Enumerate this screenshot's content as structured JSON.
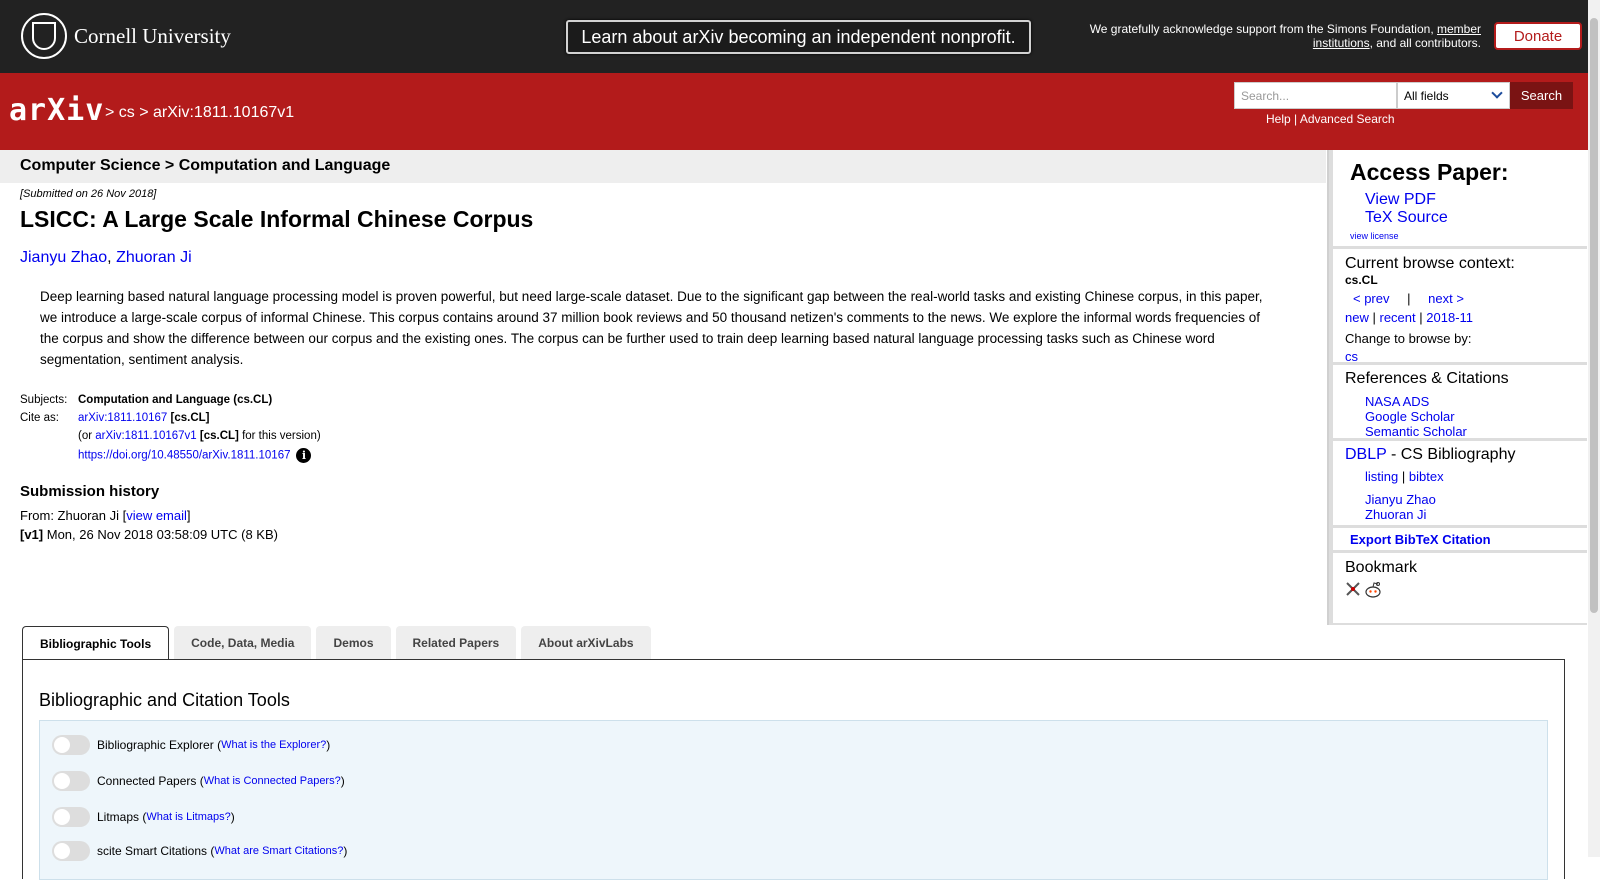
{
  "top": {
    "cornell": "Cornell University",
    "banner": "Learn about arXiv becoming an independent nonprofit.",
    "ack_prefix": "We gratefully acknowledge support from the Simons Foundation, ",
    "ack_link": "member institutions",
    "ack_suffix": ", and all contributors.",
    "donate": "Donate"
  },
  "header": {
    "logo": "arXiv",
    "bc_sep1": " > ",
    "bc_cs": "cs",
    "bc_sep2": " > ",
    "bc_id": "arXiv:1811.10167v1",
    "search_placeholder": "Search...",
    "search_field": "All fields",
    "search_button": "Search",
    "help": "Help",
    "sep": " | ",
    "advanced": "Advanced Search"
  },
  "paper": {
    "subject_bar": "Computer Science > Computation and Language",
    "submitted": "[Submitted on 26 Nov 2018]",
    "title": "LSICC: A Large Scale Informal Chinese Corpus",
    "author1": "Jianyu Zhao",
    "author_sep": ", ",
    "author2": "Zhuoran Ji",
    "abstract": "Deep learning based natural language processing model is proven powerful, but need large-scale dataset. Due to the significant gap between the real-world tasks and existing Chinese corpus, in this paper, we introduce a large-scale corpus of informal Chinese. This corpus contains around 37 million book reviews and 50 thousand netizen's comments to the news. We explore the informal words frequencies of the corpus and show the difference between our corpus and the existing ones. The corpus can be further used to train deep learning based natural language processing tasks such as Chinese word segmentation, sentiment analysis.",
    "subjects_label": "Subjects:",
    "subjects_value": "Computation and Language (cs.CL)",
    "cite_label": "Cite as:",
    "cite_id": "arXiv:1811.10167",
    "cite_cat": " [cs.CL]",
    "or_prefix": "(or ",
    "cite_v1": "arXiv:1811.10167v1",
    "cite_v1_cat": " [cs.CL]",
    "cite_v1_suffix": " for this version)",
    "doi": "https://doi.org/10.48550/arXiv.1811.10167",
    "info_icon": "i",
    "history_title": "Submission history",
    "from_prefix": "From: Zhuoran Ji [",
    "view_email": "view email",
    "from_suffix": "]",
    "v1_label": "[v1]",
    "v1_date": " Mon, 26 Nov 2018 03:58:09 UTC (8 KB)"
  },
  "sidebar": {
    "access_title": "Access Paper:",
    "view_pdf": "View PDF",
    "tex_source": "TeX Source",
    "view_license": "view license",
    "browse_title": "Current browse context:",
    "browse_cat": "cs.CL",
    "prev": "< prev",
    "pipe": "|",
    "next": "next >",
    "new": "new",
    "recent": "recent",
    "month": "2018-11",
    "change_browse": "Change to browse by:",
    "cs": "cs",
    "refs_title": "References & Citations",
    "nasa": "NASA ADS",
    "google": "Google Scholar",
    "semantic": "Semantic Scholar",
    "dblp": "DBLP",
    "dblp_suffix": " - CS Bibliography",
    "listing": "listing",
    "bibtex": "bibtex",
    "author1": "Jianyu Zhao",
    "author2": "Zhuoran Ji",
    "export": "Export BibTeX Citation",
    "bookmark": "Bookmark"
  },
  "tabs": [
    "Bibliographic Tools",
    "Code, Data, Media",
    "Demos",
    "Related Papers",
    "About arXivLabs"
  ],
  "tools": {
    "title": "Bibliographic and Citation Tools",
    "items": [
      {
        "label": "Bibliographic Explorer",
        "link": "What is the Explorer?"
      },
      {
        "label": "Connected Papers",
        "link": "What is Connected Papers?"
      },
      {
        "label": "Litmaps",
        "link": "What is Litmaps?"
      },
      {
        "label": "scite Smart Citations",
        "link": "What are Smart Citations?"
      }
    ]
  },
  "colors": {
    "brand_red": "#b31b1b",
    "dark_bar": "#222222",
    "link": "#0000ee"
  }
}
